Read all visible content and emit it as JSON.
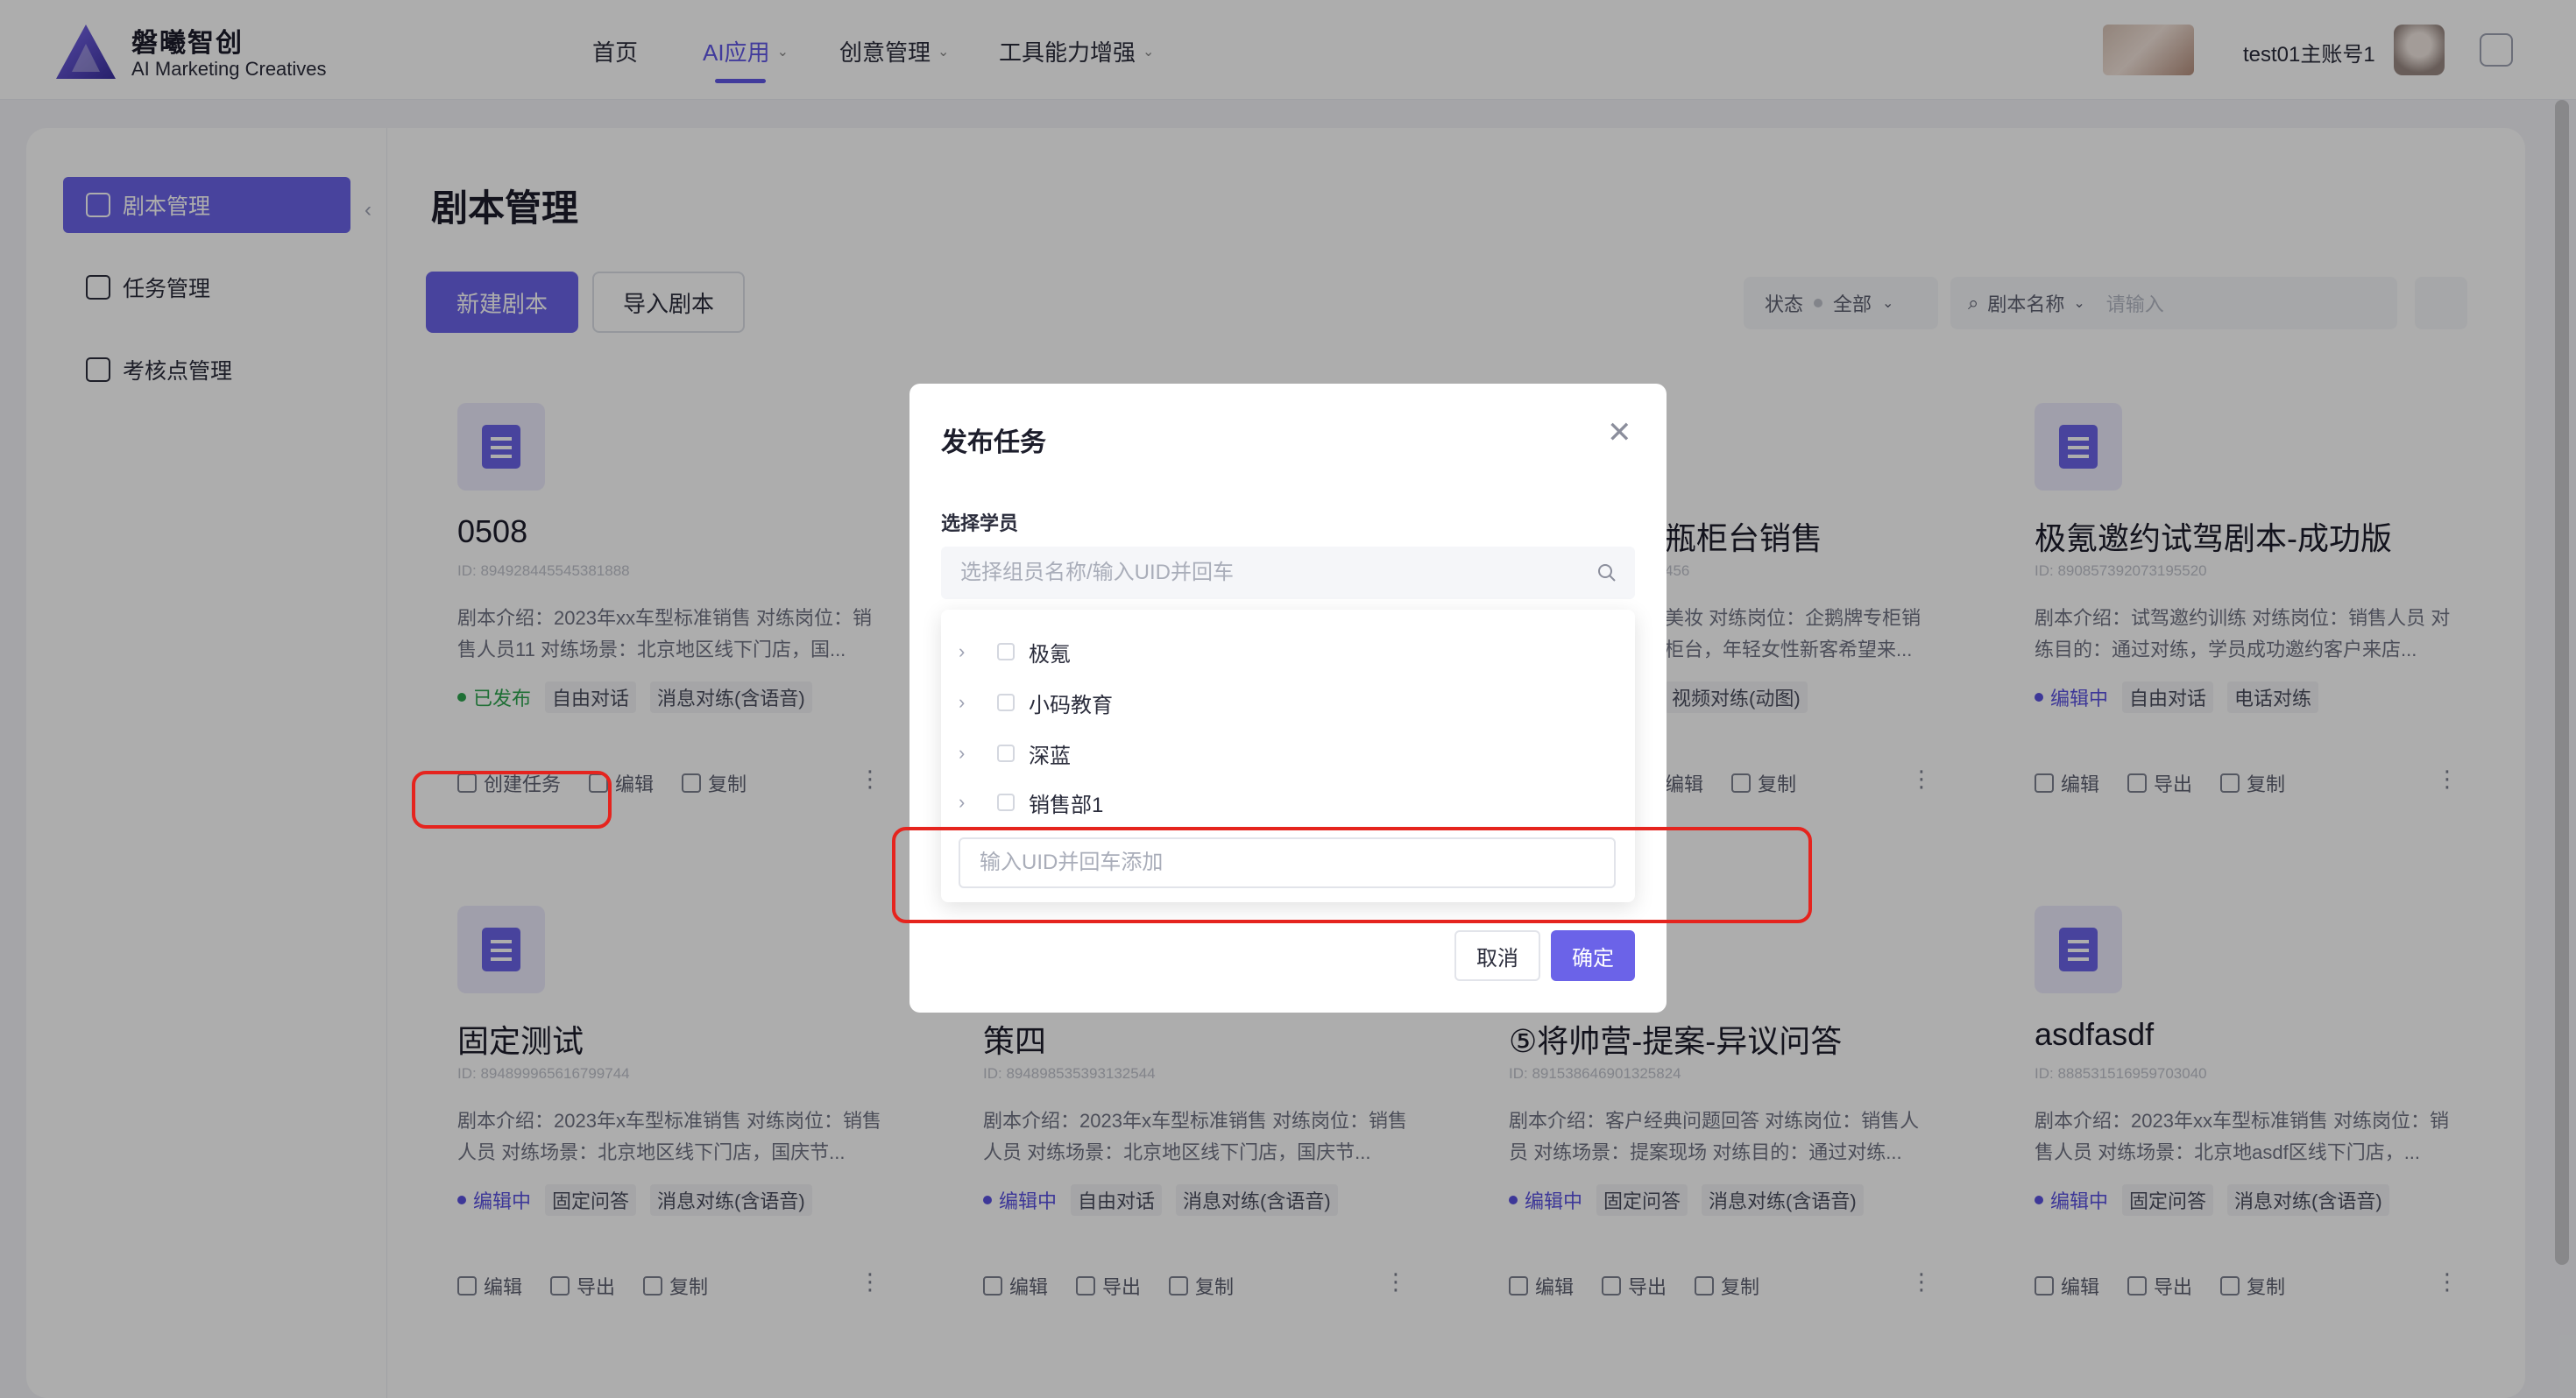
{
  "app": {
    "brand_cn": "磐曦智创",
    "brand_en": "AI Marketing Creatives",
    "account_name": "test01主账号1"
  },
  "nav": {
    "items": [
      {
        "label": "首页",
        "active": false,
        "has_dropdown": false
      },
      {
        "label": "AI应用",
        "active": true,
        "has_dropdown": true
      },
      {
        "label": "创意管理",
        "active": false,
        "has_dropdown": true
      },
      {
        "label": "工具能力增强",
        "active": false,
        "has_dropdown": true
      }
    ]
  },
  "sidebar": {
    "items": [
      {
        "label": "剧本管理",
        "icon": "book-icon",
        "active": true
      },
      {
        "label": "任务管理",
        "icon": "task-icon",
        "active": false
      },
      {
        "label": "考核点管理",
        "icon": "checklist-icon",
        "active": false
      }
    ]
  },
  "page": {
    "title": "剧本管理",
    "new_button": "新建剧本",
    "import_button": "导入剧本",
    "filter_status_label": "状态",
    "filter_status_value": "全部",
    "filter_search_field": "剧本名称",
    "filter_search_placeholder": "请输入"
  },
  "cards": [
    {
      "title": "0508",
      "id": "ID: 894928445545381888",
      "desc": "剧本介绍：2023年xx车型标准销售 对练岗位：销售人员11 对练场景：北京地区线下门店，国...",
      "status": "已发布",
      "status_type": "published",
      "tags": [
        "自由对话",
        "消息对练(含语音)"
      ],
      "actions": [
        "创建任务",
        "编辑",
        "复制"
      ]
    },
    {
      "title": "",
      "id": "",
      "desc": "",
      "status": "",
      "status_type": "",
      "tags": [],
      "actions": []
    },
    {
      "title": "瓶柜台销售",
      "id": "456",
      "desc": "美妆 对练岗位：企鹅牌专柜销 柜台，年轻女性新客希望来...",
      "status": "",
      "status_type": "",
      "tags": [
        "视频对练(动图)"
      ],
      "actions": [
        "编辑",
        "复制"
      ]
    },
    {
      "title": "极氪邀约试驾剧本-成功版",
      "id": "ID: 890857392073195520",
      "desc": "剧本介绍：试驾邀约训练 对练岗位：销售人员 对练目的：通过对练，学员成功邀约客户来店...",
      "status": "编辑中",
      "status_type": "editing",
      "tags": [
        "自由对话",
        "电话对练"
      ],
      "actions": [
        "编辑",
        "导出",
        "复制"
      ]
    },
    {
      "title": "固定测试",
      "id": "ID: 894899965616799744",
      "desc": "剧本介绍：2023年x车型标准销售 对练岗位：销售人员 对练场景：北京地区线下门店，国庆节...",
      "status": "编辑中",
      "status_type": "editing",
      "tags": [
        "固定问答",
        "消息对练(含语音)"
      ],
      "actions": [
        "编辑",
        "导出",
        "复制"
      ]
    },
    {
      "title": "策四",
      "id": "ID: 894898535393132544",
      "desc": "剧本介绍：2023年x车型标准销售 对练岗位：销售人员 对练场景：北京地区线下门店，国庆节...",
      "status": "编辑中",
      "status_type": "editing",
      "tags": [
        "自由对话",
        "消息对练(含语音)"
      ],
      "actions": [
        "编辑",
        "导出",
        "复制"
      ]
    },
    {
      "title": "⑤将帅营-提案-异议问答",
      "id": "ID: 891538646901325824",
      "desc": "剧本介绍：客户经典问题回答 对练岗位：销售人员 对练场景：提案现场 对练目的：通过对练...",
      "status": "编辑中",
      "status_type": "editing",
      "tags": [
        "固定问答",
        "消息对练(含语音)"
      ],
      "actions": [
        "编辑",
        "导出",
        "复制"
      ]
    },
    {
      "title": "asdfasdf",
      "id": "ID: 888531516959703040",
      "desc": "剧本介绍：2023年xx车型标准销售 对练岗位：销售人员 对练场景：北京地asdf区线下门店，...",
      "status": "编辑中",
      "status_type": "editing",
      "tags": [
        "固定问答",
        "消息对练(含语音)"
      ],
      "actions": [
        "编辑",
        "导出",
        "复制"
      ]
    }
  ],
  "modal": {
    "title": "发布任务",
    "field_label": "选择学员",
    "search_placeholder": "选择组员名称/输入UID并回车",
    "tree": [
      {
        "label": "极氪"
      },
      {
        "label": "小码教育"
      },
      {
        "label": "深蓝"
      },
      {
        "label": "销售部1"
      }
    ],
    "uid_placeholder": "输入UID并回车添加",
    "cancel": "取消",
    "confirm": "确定"
  },
  "colors": {
    "accent": "#6b63e8",
    "published": "#2da44e",
    "annotation_red": "#e5241e"
  }
}
